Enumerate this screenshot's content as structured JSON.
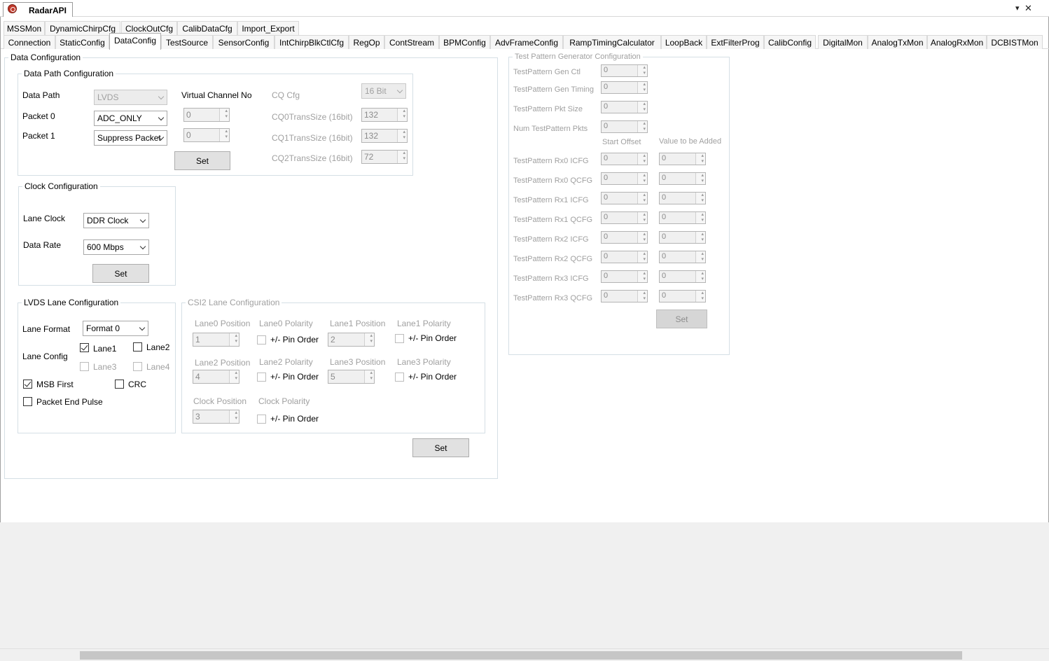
{
  "window": {
    "title": "RadarAPI",
    "dropdown_glyph": "▾",
    "close_glyph": "✕"
  },
  "tabs_row1": [
    "MSSMon",
    "DynamicChirpCfg",
    "ClockOutCfg",
    "CalibDataCfg",
    "Import_Export"
  ],
  "tabs_row2": [
    "Connection",
    "StaticConfig",
    "DataConfig",
    "TestSource",
    "SensorConfig",
    "IntChirpBlkCtlCfg",
    "RegOp",
    "ContStream",
    "BPMConfig",
    "AdvFrameConfig",
    "RampTimingCalculator",
    "LoopBack",
    "ExtFilterProg",
    "CalibConfig",
    "DigitalMon",
    "AnalogTxMon",
    "AnalogRxMon",
    "DCBISTMon"
  ],
  "active_tab": "DataConfig",
  "data_config": {
    "title": "Data Configuration",
    "data_path": {
      "title": "Data Path Configuration",
      "data_path_label": "Data Path",
      "data_path_value": "LVDS",
      "packet0_label": "Packet 0",
      "packet0_value": "ADC_ONLY",
      "packet1_label": "Packet 1",
      "packet1_value": "Suppress Packet",
      "vc_label": "Virtual Channel No",
      "vc0_value": "0",
      "vc1_value": "0",
      "set_label": "Set",
      "cq_cfg_label": "CQ Cfg",
      "cq_cfg_value": "16 Bit",
      "cq0_label": "CQ0TransSize (16bit)",
      "cq0_value": "132",
      "cq1_label": "CQ1TransSize (16bit)",
      "cq1_value": "132",
      "cq2_label": "CQ2TransSize (16bit)",
      "cq2_value": "72"
    },
    "clock": {
      "title": "Clock Configuration",
      "lane_clock_label": "Lane Clock",
      "lane_clock_value": "DDR Clock",
      "data_rate_label": "Data Rate",
      "data_rate_value": "600 Mbps",
      "set_label": "Set"
    },
    "lvds": {
      "title": "LVDS Lane Configuration",
      "lane_format_label": "Lane Format",
      "lane_format_value": "Format 0",
      "lane_config_label": "Lane Config",
      "lane1": "Lane1",
      "lane2": "Lane2",
      "lane3": "Lane3",
      "lane4": "Lane4",
      "msb_first": "MSB First",
      "crc": "CRC",
      "packet_end_pulse": "Packet End Pulse",
      "checked": {
        "lane1": true,
        "lane2": false,
        "lane3": false,
        "lane4": false,
        "msb_first": true,
        "crc": false,
        "packet_end_pulse": false
      }
    },
    "csi2": {
      "title": "CSI2 Lane Configuration",
      "lane0_pos_label": "Lane0 Position",
      "lane0_pos": "1",
      "lane0_pol_label": "Lane0 Polarity",
      "lane1_pos_label": "Lane1 Position",
      "lane1_pos": "2",
      "lane1_pol_label": "Lane1 Polarity",
      "lane2_pos_label": "Lane2 Position",
      "lane2_pos": "4",
      "lane2_pol_label": "Lane2 Polarity",
      "lane3_pos_label": "Lane3 Position",
      "lane3_pos": "5",
      "lane3_pol_label": "Lane3 Polarity",
      "clock_pos_label": "Clock Position",
      "clock_pos": "3",
      "clock_pol_label": "Clock Polarity",
      "pin_order": "+/- Pin Order",
      "set_label": "Set"
    }
  },
  "test_pattern": {
    "title": "Test Pattern Generator Configuration",
    "gen_ctl_label": "TestPattern Gen Ctl",
    "gen_ctl": "0",
    "gen_timing_label": "TestPattern Gen Timing",
    "gen_timing": "0",
    "pkt_size_label": "TestPattern Pkt Size",
    "pkt_size": "0",
    "num_pkts_label": "Num TestPattern Pkts",
    "num_pkts": "0",
    "start_offset_label": "Start Offset",
    "value_added_label": "Value to be Added",
    "rows": [
      {
        "label": "TestPattern Rx0 ICFG",
        "offset": "0",
        "value": "0"
      },
      {
        "label": "TestPattern Rx0 QCFG",
        "offset": "0",
        "value": "0"
      },
      {
        "label": "TestPattern Rx1 ICFG",
        "offset": "0",
        "value": "0"
      },
      {
        "label": "TestPattern Rx1 QCFG",
        "offset": "0",
        "value": "0"
      },
      {
        "label": "TestPattern Rx2 ICFG",
        "offset": "0",
        "value": "0"
      },
      {
        "label": "TestPattern Rx2 QCFG",
        "offset": "0",
        "value": "0"
      },
      {
        "label": "TestPattern Rx3 ICFG",
        "offset": "0",
        "value": "0"
      },
      {
        "label": "TestPattern Rx3 QCFG",
        "offset": "0",
        "value": "0"
      }
    ],
    "set_label": "Set"
  }
}
